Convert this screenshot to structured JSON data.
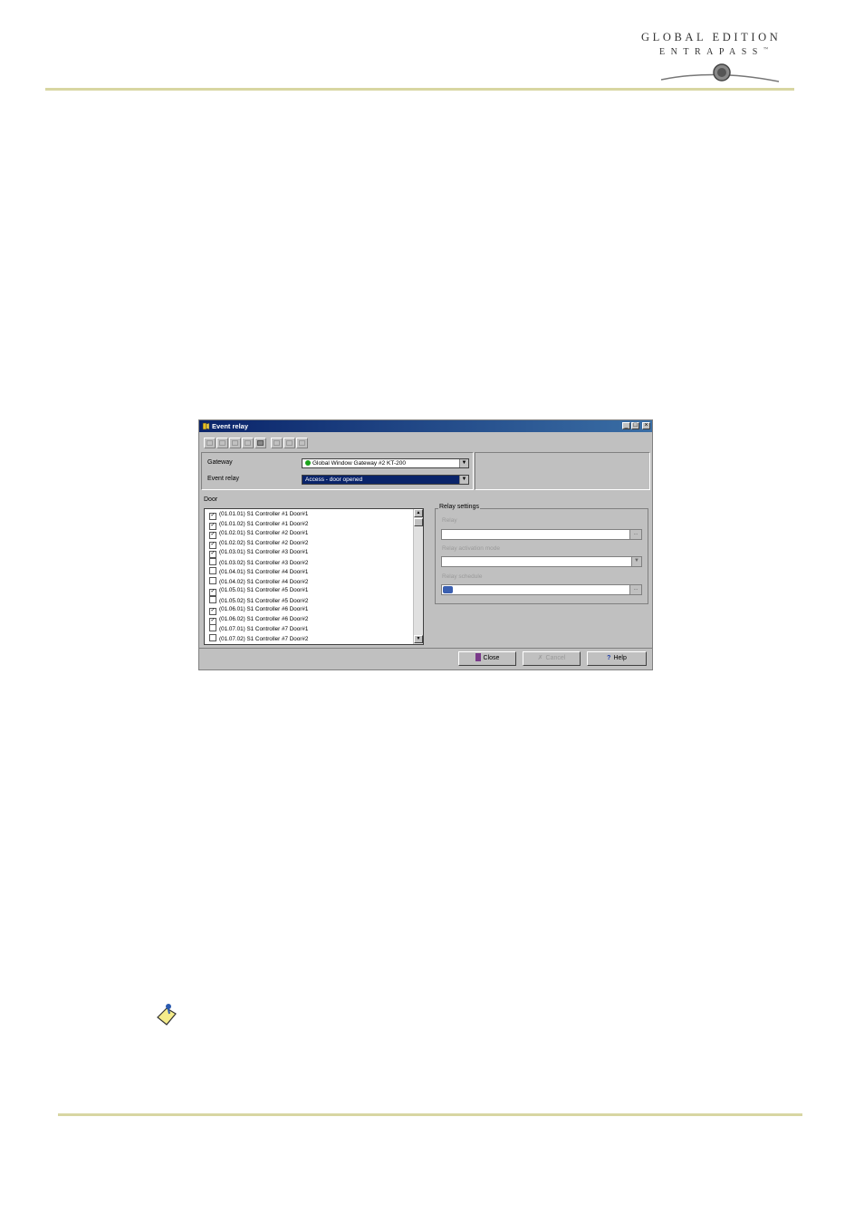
{
  "header": {
    "logo_line1": "GLOBAL EDITION",
    "logo_line2": "ENTRAPASS",
    "logo_mark": "™"
  },
  "window": {
    "title": "Event relay",
    "title_icon": "event-relay-icon",
    "controls": [
      "_",
      "□",
      "×"
    ],
    "gateway_label": "Gateway",
    "gateway_value": "Global Window Gateway #2  KT-200",
    "event_relay_label": "Event relay",
    "event_relay_value": "Access - door opened",
    "door_label": "Door",
    "doors": [
      {
        "label": "(01.01.01) S1 Controller #1 Door#1",
        "checked": true
      },
      {
        "label": "(01.01.02) S1 Controller #1 Door#2",
        "checked": true
      },
      {
        "label": "(01.02.01) S1 Controller #2 Door#1",
        "checked": true
      },
      {
        "label": "(01.02.02) S1 Controller #2 Door#2",
        "checked": true
      },
      {
        "label": "(01.03.01) S1 Controller #3 Door#1",
        "checked": true
      },
      {
        "label": "(01.03.02) S1 Controller #3 Door#2",
        "checked": false
      },
      {
        "label": "(01.04.01) S1 Controller #4 Door#1",
        "checked": false
      },
      {
        "label": "(01.04.02) S1 Controller #4 Door#2",
        "checked": false
      },
      {
        "label": "(01.05.01) S1 Controller #5 Door#1",
        "checked": true
      },
      {
        "label": "(01.05.02) S1 Controller #5 Door#2",
        "checked": false
      },
      {
        "label": "(01.06.01) S1 Controller #6 Door#1",
        "checked": true
      },
      {
        "label": "(01.06.02) S1 Controller #6 Door#2",
        "checked": true
      },
      {
        "label": "(01.07.01) S1 Controller #7 Door#1",
        "checked": false
      },
      {
        "label": "(01.07.02) S1 Controller #7 Door#2",
        "checked": false
      }
    ],
    "relay_settings": {
      "group_label": "Relay settings",
      "relay_label": "Relay",
      "activation_mode_label": "Relay activation mode",
      "schedule_label": "Relay schedule"
    },
    "buttons": {
      "close": "Close",
      "cancel": "Cancel",
      "help": "Help"
    }
  },
  "colors": {
    "rule": "#d8d6a2",
    "titlebar": "#0a246a",
    "selected": "#0a246a",
    "status_green": "#1aa31a"
  }
}
